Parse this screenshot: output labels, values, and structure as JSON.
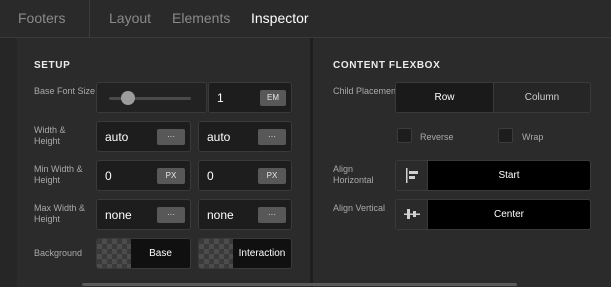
{
  "topbar": {
    "tabs": [
      "Footers",
      "Layout",
      "Elements",
      "Inspector"
    ],
    "active_tab": "Inspector"
  },
  "setup": {
    "title": "SETUP",
    "base_font_size": {
      "label": "Base Font Size",
      "value": "1",
      "unit": "EM",
      "slider_level": 0.2
    },
    "width_height": {
      "label": "Width & Height",
      "width": "auto",
      "height": "auto",
      "menu_glyph": "···"
    },
    "min_width_height": {
      "label": "Min Width & Height",
      "width": "0",
      "height": "0",
      "unit": "PX"
    },
    "max_width_height": {
      "label": "Max Width & Height",
      "width": "none",
      "height": "none",
      "menu_glyph": "···"
    },
    "background": {
      "label": "Background",
      "base": "Base",
      "interaction": "Interaction"
    }
  },
  "flexbox": {
    "title": "CONTENT FLEXBOX",
    "child_placement": {
      "label": "Child Placement",
      "options": [
        "Row",
        "Column"
      ],
      "selected": "Row"
    },
    "reverse": {
      "label": "Reverse",
      "checked": false
    },
    "wrap": {
      "label": "Wrap",
      "checked": false
    },
    "align_horizontal": {
      "label": "Align Horizontal",
      "value": "Start"
    },
    "align_vertical": {
      "label": "Align Vertical",
      "value": "Center"
    }
  },
  "colors": {
    "panel_bg": "#2b2b2b",
    "input_bg": "#1d1d1d",
    "accent_active": "#ffffff"
  }
}
